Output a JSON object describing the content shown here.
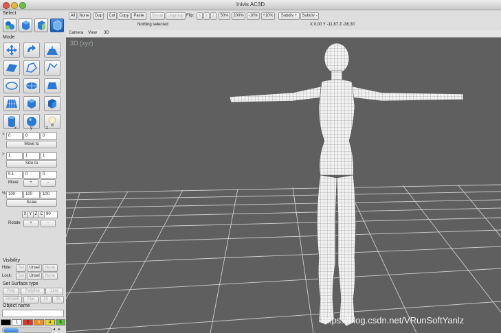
{
  "window": {
    "title": "Inivis AC3D"
  },
  "toolbar": {
    "all": "All",
    "none": "None",
    "dup": "Dup",
    "cut": "Cut",
    "copy": "Copy",
    "paste": "Paste",
    "group": "Group",
    "ungroup": "Ungroup",
    "flip_label": "Flip:",
    "flip_x": "X",
    "flip_y": "Y",
    "flip_z": "Z",
    "zoom50": "50%",
    "zoom200": "200%",
    "zoom_minus": "-10%",
    "zoom_plus": "+10%",
    "subdiv_plus": "Subdiv +",
    "subdiv_minus": "Subdiv -",
    "status": "Nothing selected",
    "coords": "X 0.00 Y -11.87 Z -36.30"
  },
  "viewmenu": {
    "camera": "Camera",
    "view": "View",
    "threed": "3D"
  },
  "viewport": {
    "label": "3D (xyz)",
    "watermark": "https://blog.csdn.net/VRunSoftYanlz"
  },
  "left": {
    "select_label": "Select",
    "mode_label": "Mode",
    "axis_x": "x",
    "axis_y": "y",
    "axis_z": "z",
    "move_vals": [
      "0",
      "0",
      "0"
    ],
    "move_to": "Move to",
    "size_vals": [
      "1",
      "1",
      "1"
    ],
    "size_to": "Size to",
    "step_vals": [
      "0.1",
      "0",
      "0"
    ],
    "move": "Move",
    "plus": "+",
    "minus": "-",
    "scale_vals": [
      "100",
      "100",
      "100"
    ],
    "pct": "%",
    "scale": "Scale",
    "rot_x": "X",
    "rot_y": "Y",
    "rot_z": "Z",
    "rot_c": "C",
    "rot_val": "90",
    "rotate": "Rotate",
    "visibility_label": "Visibility",
    "hide_label": "Hide:",
    "lock_label": "Lock:",
    "sel": "Sel",
    "unsel": "Unsel",
    "none": "None",
    "surface_label": "Set Surface type",
    "poly": "Poly",
    "polyline": "Polyline",
    "line": "Line",
    "smooth": "Smooth",
    "flat": "Flat",
    "s1": "1S",
    "s2": "2S",
    "object_name_label": "Object name",
    "palette_nums": [
      "1",
      "2",
      "3",
      "4",
      "5"
    ],
    "palette_colors": [
      "#000000",
      "#ffffff",
      "#d33a2c",
      "#ee8a20",
      "#e8d52a",
      "#5fc23a"
    ]
  }
}
